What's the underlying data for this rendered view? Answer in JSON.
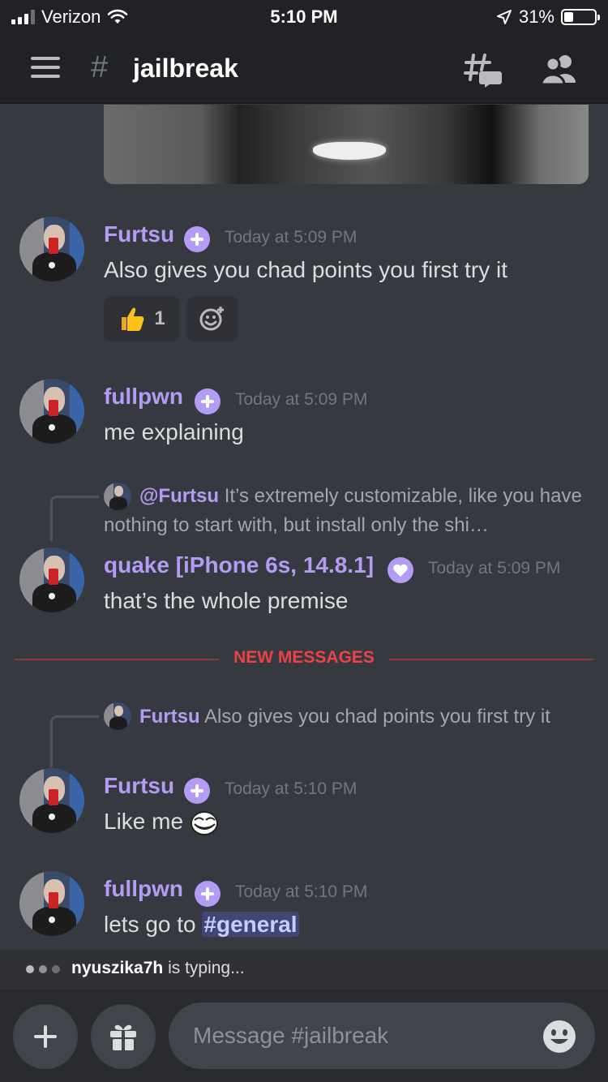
{
  "status_bar": {
    "carrier": "Verizon",
    "time": "5:10 PM",
    "battery": "31%",
    "battery_level": 0.31
  },
  "header": {
    "hash_symbol": "#",
    "channel_name": "jailbreak"
  },
  "messages": [
    {
      "author": "Furtsu",
      "timestamp": "Today at 5:09 PM",
      "text": "Also gives you chad points  you first try it",
      "reactions": [
        {
          "emoji": "thumbs-up",
          "count": "1"
        }
      ]
    },
    {
      "author": "fullpwn",
      "timestamp": "Today at 5:09 PM",
      "text": "me explaining"
    },
    {
      "reply": {
        "author": "@Furtsu",
        "text": "It’s extremely customizable, like you have nothing to start with, but install only the shi…"
      },
      "author": "quake [iPhone 6s, 14.8.1]",
      "timestamp": "Today at 5:09 PM",
      "text": "that’s the whole premise"
    },
    {
      "reply": {
        "author": "Furtsu",
        "text": "Also gives you chad points  you first try it"
      },
      "author": "Furtsu",
      "timestamp": "Today at 5:10 PM",
      "text": "Like me"
    },
    {
      "author": "fullpwn",
      "timestamp": "Today at 5:10 PM",
      "text": "lets go to ",
      "channel_link": "#general"
    }
  ],
  "divider": {
    "label": "NEW MESSAGES"
  },
  "typing": {
    "user": "nyuszika7h",
    "suffix": "is typing..."
  },
  "composer": {
    "placeholder": "Message #jailbreak"
  },
  "colors": {
    "background": "#36393f",
    "header": "#202225",
    "username": "#b49cf5",
    "new_messages": "#ed4245",
    "mention_bg": "#414675"
  }
}
